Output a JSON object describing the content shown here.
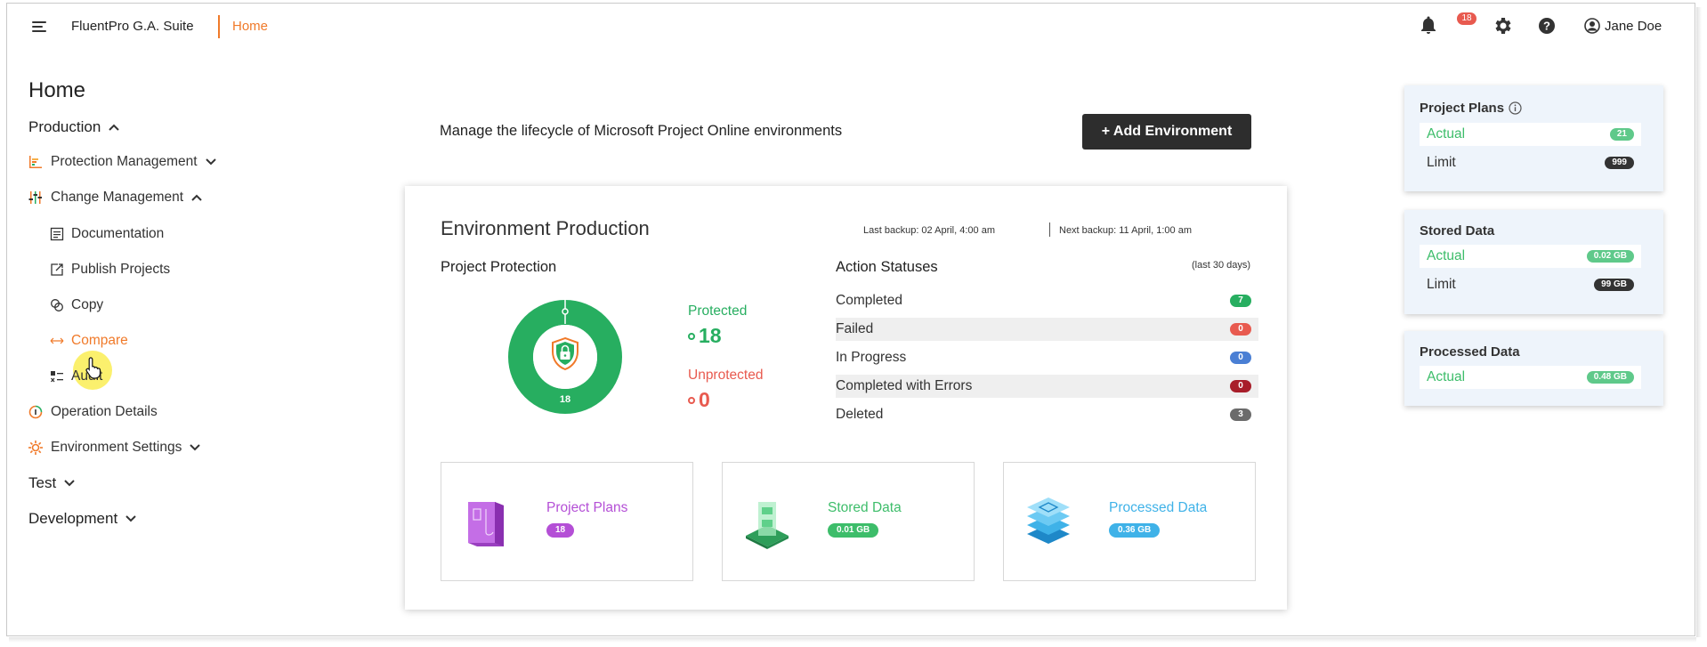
{
  "header": {
    "app_name": "FluentPro G.A. Suite",
    "breadcrumb": "Home",
    "notification_count": "18",
    "user_name": "Jane Doe",
    "accent_color": "#f07a2a"
  },
  "sidebar": {
    "page_title": "Home",
    "production_label": "Production",
    "protection_label": "Protection Management",
    "change_label": "Change Management",
    "sub_items": {
      "documentation": "Documentation",
      "publish": "Publish Projects",
      "copy": "Copy",
      "compare": "Compare",
      "audit": "Audit"
    },
    "operation_label": "Operation Details",
    "env_settings_label": "Environment Settings",
    "test_label": "Test",
    "development_label": "Development"
  },
  "main": {
    "manage_text": "Manage the lifecycle of Microsoft Project Online environments",
    "add_button": "+ Add Environment",
    "environment": {
      "title": "Environment Production",
      "last_backup": "Last backup: 02 April, 4:00 am",
      "next_backup": "Next backup: 11 April, 1:00 am",
      "protection_title": "Project Protection",
      "donut_total": "18",
      "protected_label": "Protected",
      "protected_value": "18",
      "unprotected_label": "Unprotected",
      "unprotected_value": "0",
      "statuses_title": "Action Statuses",
      "statuses_period": "(last 30 days)",
      "statuses": [
        {
          "label": "Completed",
          "count": "7",
          "color": "#27ae60"
        },
        {
          "label": "Failed",
          "count": "0",
          "color": "#e85a4f"
        },
        {
          "label": "In Progress",
          "count": "0",
          "color": "#4a7fd4"
        },
        {
          "label": "Completed with Errors",
          "count": "0",
          "color": "#a81e2a"
        },
        {
          "label": "Deleted",
          "count": "3",
          "color": "#6b6b6b"
        }
      ],
      "cards": [
        {
          "title": "Project Plans",
          "value": "18",
          "color": "#b44fd6",
          "icon": "project-plans-icon"
        },
        {
          "title": "Stored Data",
          "value": "0.01 GB",
          "color": "#3dbd6a",
          "icon": "stored-data-icon"
        },
        {
          "title": "Processed Data",
          "value": "0.36 GB",
          "color": "#3fb2e8",
          "icon": "processed-data-icon"
        }
      ]
    }
  },
  "usage": {
    "project_plans": {
      "title": "Project Plans",
      "actual_label": "Actual",
      "actual": "21",
      "limit_label": "Limit",
      "limit": "999"
    },
    "stored_data": {
      "title": "Stored Data",
      "actual_label": "Actual",
      "actual": "0.02 GB",
      "limit_label": "Limit",
      "limit": "99 GB"
    },
    "processed_data": {
      "title": "Processed Data",
      "actual_label": "Actual",
      "actual": "0.48 GB"
    }
  }
}
